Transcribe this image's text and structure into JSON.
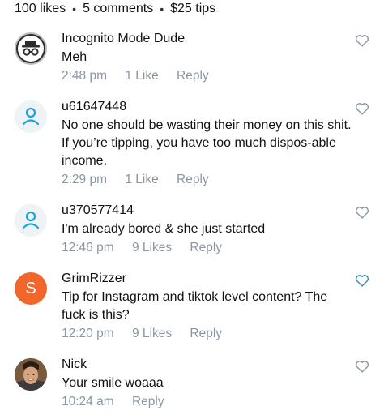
{
  "stats": {
    "likes": "100 likes",
    "comments": "5 comments",
    "tips": "$25 tips",
    "separator": "•"
  },
  "comments": [
    {
      "username": "Incognito Mode Dude",
      "text": "Meh",
      "time": "2:48 pm",
      "likes": "1 Like",
      "reply": "Reply",
      "avatar": "incognito-icon",
      "heart_color": "#8a96a3"
    },
    {
      "username": "u61647448",
      "text": "No one should be wasting their money on this shit. If you’re tipping, you have too much dispos-able income.",
      "time": "2:29 pm",
      "likes": "1 Like",
      "reply": "Reply",
      "avatar": "default-user-icon",
      "heart_color": "#8a96a3"
    },
    {
      "username": "u370577414",
      "text": "I'm already bored & she just started",
      "time": "12:46 pm",
      "likes": "9 Likes",
      "reply": "Reply",
      "avatar": "default-user-icon",
      "heart_color": "#8a96a3"
    },
    {
      "username": "GrimRizzer",
      "text": "Tip for Instagram and tiktok level content? The fuck is this?",
      "time": "12:20 pm",
      "likes": "9 Likes",
      "reply": "Reply",
      "avatar_letter": "S",
      "avatar_color": "#f0662b",
      "heart_color": "#2f8fb8"
    },
    {
      "username": "Nick",
      "text": "Your smile woaaa",
      "time": "10:24 am",
      "likes": "",
      "reply": "Reply",
      "avatar": "profile-photo",
      "heart_color": "#8a96a3"
    }
  ],
  "colors": {
    "meta_text": "#8a96a3",
    "primary_text": "#111111",
    "default_avatar_bg": "#eef3f7",
    "default_avatar_icon": "#1aa3d9"
  }
}
